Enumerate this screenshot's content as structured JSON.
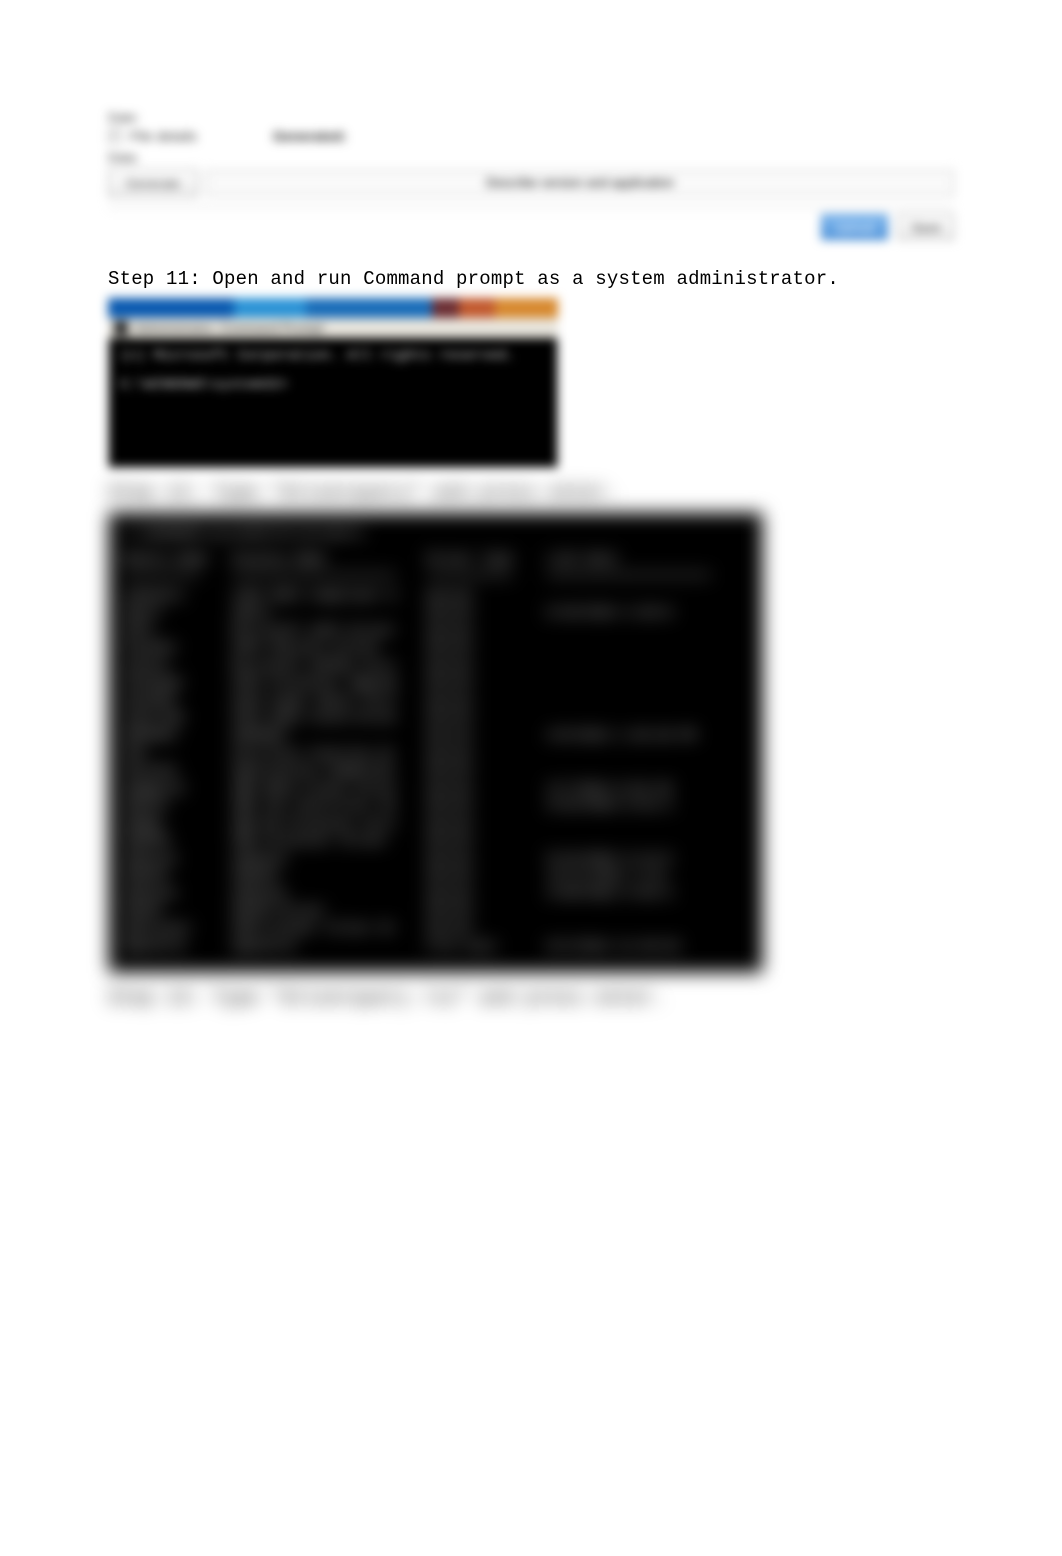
{
  "top_dialog": {
    "label_top": "Date:",
    "checkbox_label": "File details",
    "bold_part": "Generated:",
    "rest_part": "",
    "label_mid": "Data:",
    "file_placeholder": "Describe version and application",
    "update_label": "Generate",
    "ok_label": "Upload",
    "cancel_label": "Save"
  },
  "steps": {
    "s11": "Step 11:  Open and run Command prompt as a system administrator.",
    "s12": "Step 12:  Type \"driverquery\" and press enter.",
    "s13": "Step 13:  Type \"driverquery /si\" and press enter."
  },
  "cmd_small": {
    "subtitle": "Administrator: Command Prompt",
    "line1": "(c) Microsoft Corporation. All rights reserved.",
    "line2": "C:\\WINDOWS\\system32>"
  },
  "cmd_large": {
    "prompt": "C:\\WINDOWS\\system32>driverquery",
    "headers": {
      "c1": "Module Name",
      "c2": "Display Name",
      "c3": "Driver Type",
      "c4": "Link Date"
    },
    "rows": [
      {
        "c1": "1394ohci",
        "c2": "1394 OHCI Compliant H",
        "c3": "Kernel",
        "c4": ""
      },
      {
        "c1": "3ware",
        "c2": "3ware",
        "c3": "Kernel",
        "c4": "5/18/2015 3:28:0"
      },
      {
        "c1": "ACPI",
        "c2": "Microsoft ACPI Driver",
        "c3": "Kernel",
        "c4": ""
      },
      {
        "c1": "AcpiDev",
        "c2": "ACPI Devices driver",
        "c3": "Kernel",
        "c4": ""
      },
      {
        "c1": "acpiex",
        "c2": "Microsoft ACPIEx Driv",
        "c3": "Kernel",
        "c4": ""
      },
      {
        "c1": "acpipagr",
        "c2": "ACPI Processor Aggreg",
        "c3": "Kernel",
        "c4": ""
      },
      {
        "c1": "AcpiPmi",
        "c2": "ACPI Power Meter Driv",
        "c3": "Kernel",
        "c4": ""
      },
      {
        "c1": "acpitime",
        "c2": "ACPI Wake Alarm Drive",
        "c3": "Kernel",
        "c4": ""
      },
      {
        "c1": "ADP80XX",
        "c2": "ADP80XX",
        "c3": "Kernel",
        "c4": "4/9/2015 1:49:48 PM"
      },
      {
        "c1": "AFD",
        "c2": "Ancillary Function Dr",
        "c3": "Kernel",
        "c4": ""
      },
      {
        "c1": "ahcache",
        "c2": "Application Compatibi",
        "c3": "Kernel",
        "c4": ""
      },
      {
        "c1": "amdgpio2",
        "c2": "AMD GPIO Client Drive",
        "c3": "Kernel",
        "c4": "2/7/2019 8:52:29"
      },
      {
        "c1": "amdi2c",
        "c2": "AMD I2C Controller Se",
        "c3": "Kernel",
        "c4": "3/15/2019 8:51:4"
      },
      {
        "c1": "AmdK8",
        "c2": "AMD K8 Processor Driv",
        "c3": "Kernel",
        "c4": ""
      },
      {
        "c1": "AmdPPM",
        "c2": "AMD Processor Driver",
        "c3": "Kernel",
        "c4": ""
      },
      {
        "c1": "amdsata",
        "c2": "amdsata",
        "c3": "Kernel",
        "c4": "5/14/2015 6:14:5"
      },
      {
        "c1": "amdsbs",
        "c2": "amdsbs",
        "c3": "Kernel",
        "c4": "12/11/2012 2:21:"
      },
      {
        "c1": "amdxata",
        "c2": "amdxata",
        "c3": "Kernel",
        "c4": "4/30/2015 6:55:3"
      },
      {
        "c1": "AppID",
        "c2": "AppID Driver",
        "c3": "Kernel",
        "c4": ""
      },
      {
        "c1": "applocker",
        "c2": "Smartlocker Filter Dr",
        "c3": "Kernel",
        "c4": ""
      },
      {
        "c1": "AppvStrm",
        "c2": "AppvStrm",
        "c3": "File Syst",
        "c4": "8/2/2019 12:40:04"
      }
    ]
  }
}
